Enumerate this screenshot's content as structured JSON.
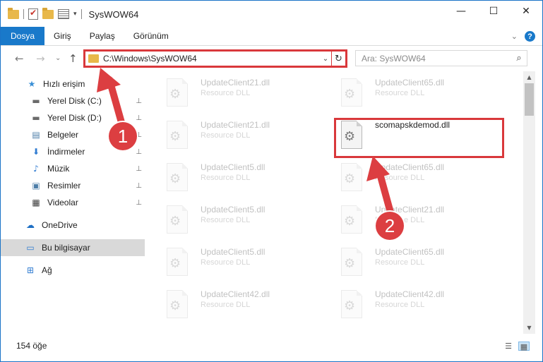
{
  "window": {
    "title": "SysWOW64",
    "controls": {
      "minimize": "—",
      "maximize": "☐",
      "close": "✕"
    }
  },
  "ribbon": {
    "tabs": [
      "Dosya",
      "Giriş",
      "Paylaş",
      "Görünüm"
    ],
    "expand_icon": "chevron-down-icon",
    "help": "?"
  },
  "navigation": {
    "back": "←",
    "forward": "→",
    "recent": "⌄",
    "up": "↑",
    "address": "C:\\Windows\\SysWOW64",
    "address_dropdown": "⌄",
    "refresh": "↻",
    "search_placeholder": "Ara: SysWOW64",
    "search_icon": "⌕"
  },
  "sidebar": {
    "items": [
      {
        "label": "Hızlı erişim",
        "icon": "star-icon",
        "glyph": "★",
        "color": "#3a8fd6",
        "pinned": false
      },
      {
        "label": "Yerel Disk (C:)",
        "icon": "drive-icon",
        "glyph": "▬",
        "color": "#6a6a6a",
        "pinned": true
      },
      {
        "label": "Yerel Disk (D:)",
        "icon": "drive-icon",
        "glyph": "▬",
        "color": "#6a6a6a",
        "pinned": true
      },
      {
        "label": "Belgeler",
        "icon": "documents-icon",
        "glyph": "▤",
        "color": "#4d7ea8",
        "pinned": true
      },
      {
        "label": "İndirmeler",
        "icon": "downloads-icon",
        "glyph": "⬇",
        "color": "#2f7bd1",
        "pinned": true
      },
      {
        "label": "Müzik",
        "icon": "music-icon",
        "glyph": "♪",
        "color": "#2f7bd1",
        "pinned": true
      },
      {
        "label": "Resimler",
        "icon": "pictures-icon",
        "glyph": "▣",
        "color": "#4d7ea8",
        "pinned": true
      },
      {
        "label": "Videolar",
        "icon": "videos-icon",
        "glyph": "▦",
        "color": "#3d3d3d",
        "pinned": true
      },
      {
        "label": "OneDrive",
        "icon": "cloud-icon",
        "glyph": "☁",
        "color": "#1e6fc4",
        "pinned": false
      },
      {
        "label": "Bu bilgisayar",
        "icon": "computer-icon",
        "glyph": "▭",
        "color": "#2f7bd1",
        "pinned": false,
        "selected": true
      },
      {
        "label": "Ağ",
        "icon": "network-icon",
        "glyph": "⊞",
        "color": "#2f7bd1",
        "pinned": false
      }
    ],
    "pin_glyph": "📌"
  },
  "files": {
    "items": [
      {
        "name": "UpdateClient21.dll",
        "type": "Resource DLL",
        "faded": true
      },
      {
        "name": "UpdateClient65.dll",
        "type": "Resource DLL",
        "faded": true
      },
      {
        "name": "UpdateClient21.dll",
        "type": "Resource DLL",
        "faded": true
      },
      {
        "name": "scomapskdemod.dll",
        "type": "",
        "faded": false,
        "highlighted": true
      },
      {
        "name": "UpdateClient5.dll",
        "type": "Resource DLL",
        "faded": true
      },
      {
        "name": "UpdateClient65.dll",
        "type": "Resource DLL",
        "faded": true
      },
      {
        "name": "UpdateClient5.dll",
        "type": "Resource DLL",
        "faded": true
      },
      {
        "name": "UpdateClient21.dll",
        "type": "Resource DLL",
        "faded": true
      },
      {
        "name": "UpdateClient5.dll",
        "type": "Resource DLL",
        "faded": true
      },
      {
        "name": "UpdateClient65.dll",
        "type": "Resource DLL",
        "faded": true
      },
      {
        "name": "UpdateClient42.dll",
        "type": "Resource DLL",
        "faded": true
      },
      {
        "name": "UpdateClient42.dll",
        "type": "Resource DLL",
        "faded": true
      }
    ]
  },
  "status": {
    "count": "154 öğe"
  },
  "annotations": {
    "badge1": "1",
    "badge2": "2",
    "color": "#dc3e41"
  }
}
